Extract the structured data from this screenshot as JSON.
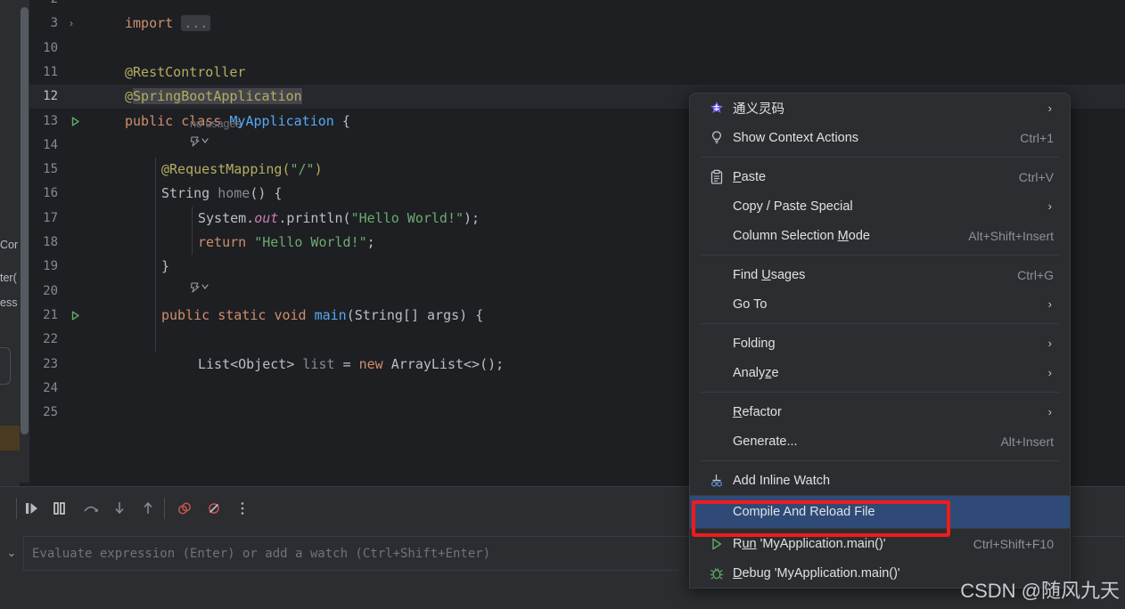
{
  "app": {
    "theme_bg": "#1e1f22",
    "panel_bg": "#2b2d30",
    "accent_selected": "#2f4a76",
    "annotation_color": "#ef1c1c"
  },
  "editor": {
    "lines": [
      {
        "num": "2",
        "indent": 0,
        "segments": []
      },
      {
        "num": "3",
        "indent": 0,
        "fold": "›",
        "segments": [
          {
            "t": "import ",
            "c": "kw"
          },
          {
            "t": "...",
            "c": "dots"
          }
        ]
      },
      {
        "num": "10",
        "indent": 0,
        "segments": []
      },
      {
        "num": "11",
        "indent": 0,
        "segments": [
          {
            "t": "@RestController",
            "c": "anno"
          }
        ]
      },
      {
        "num": "12",
        "indent": 0,
        "current": true,
        "segments": [
          {
            "t": "@",
            "c": "anno"
          },
          {
            "t": "SpringBootApplication",
            "c": "anno sel"
          }
        ]
      },
      {
        "num": "13",
        "indent": 0,
        "run": true,
        "segments": [
          {
            "t": "public ",
            "c": "kw"
          },
          {
            "t": "class ",
            "c": "kw"
          },
          {
            "t": "MyApplication",
            "c": "mth"
          },
          {
            "t": " {",
            "c": "plain"
          }
        ]
      },
      {
        "num": "14",
        "indent": 0,
        "segments": []
      },
      {
        "num": "15",
        "indent": 1,
        "segments": [
          {
            "t": "@RequestMapping(",
            "c": "anno"
          },
          {
            "t": "\"/\"",
            "c": "str"
          },
          {
            "t": ")",
            "c": "anno"
          }
        ]
      },
      {
        "num": "16",
        "indent": 1,
        "segments": [
          {
            "t": "String ",
            "c": "plain"
          },
          {
            "t": "home",
            "c": "dim"
          },
          {
            "t": "() {",
            "c": "plain"
          }
        ]
      },
      {
        "num": "17",
        "indent": 2,
        "segments": [
          {
            "t": "System.",
            "c": "plain"
          },
          {
            "t": "out",
            "c": "fld"
          },
          {
            "t": ".println(",
            "c": "plain"
          },
          {
            "t": "\"Hello World!\"",
            "c": "str"
          },
          {
            "t": ");",
            "c": "plain"
          }
        ]
      },
      {
        "num": "18",
        "indent": 2,
        "segments": [
          {
            "t": "return ",
            "c": "kw"
          },
          {
            "t": "\"Hello World!\"",
            "c": "str"
          },
          {
            "t": ";",
            "c": "plain"
          }
        ]
      },
      {
        "num": "19",
        "indent": 1,
        "segments": [
          {
            "t": "}",
            "c": "plain"
          }
        ]
      },
      {
        "num": "20",
        "indent": 0,
        "segments": []
      },
      {
        "num": "21",
        "indent": 1,
        "run": true,
        "segments": [
          {
            "t": "public ",
            "c": "kw"
          },
          {
            "t": "static ",
            "c": "kw"
          },
          {
            "t": "void ",
            "c": "kw"
          },
          {
            "t": "main",
            "c": "mth"
          },
          {
            "t": "(String[] args) {",
            "c": "plain"
          }
        ]
      },
      {
        "num": "22",
        "indent": 0,
        "segments": []
      },
      {
        "num": "23",
        "indent": 2,
        "segments": [
          {
            "t": "List<Object> ",
            "c": "plain"
          },
          {
            "t": "list ",
            "c": "dim"
          },
          {
            "t": "= ",
            "c": "plain"
          },
          {
            "t": "new ",
            "c": "kw"
          },
          {
            "t": "ArrayList<>();",
            "c": "plain"
          }
        ]
      },
      {
        "num": "24",
        "indent": 0,
        "segments": []
      },
      {
        "num": "25",
        "indent": 0,
        "segments": []
      }
    ],
    "inlay_no_usages": "no usages",
    "left_strip_fragments": [
      "Cor",
      "ter(",
      "ess"
    ]
  },
  "context_menu": {
    "items": [
      {
        "kind": "item",
        "icon": "tongyi-lingma-icon",
        "label": "通义灵码",
        "submenu": true
      },
      {
        "kind": "item",
        "icon": "lightbulb-icon",
        "label": "Show Context Actions",
        "shortcut": "Ctrl+1"
      },
      {
        "kind": "separator"
      },
      {
        "kind": "item",
        "icon": "clipboard-icon",
        "label": "Paste",
        "mnemonic": "P",
        "shortcut": "Ctrl+V"
      },
      {
        "kind": "item",
        "label": "Copy / Paste Special",
        "submenu": true
      },
      {
        "kind": "item",
        "label": "Column Selection Mode",
        "mnemonic": "M",
        "shortcut": "Alt+Shift+Insert"
      },
      {
        "kind": "separator"
      },
      {
        "kind": "item",
        "label": "Find Usages",
        "mnemonic": "U",
        "shortcut": "Ctrl+G"
      },
      {
        "kind": "item",
        "label": "Go To",
        "submenu": true
      },
      {
        "kind": "separator"
      },
      {
        "kind": "item",
        "label": "Folding",
        "submenu": true
      },
      {
        "kind": "item",
        "label": "Analyze",
        "mnemonic": "z",
        "submenu": true
      },
      {
        "kind": "separator"
      },
      {
        "kind": "item",
        "label": "Refactor",
        "mnemonic": "R",
        "submenu": true
      },
      {
        "kind": "item",
        "label": "Generate...",
        "shortcut": "Alt+Insert"
      },
      {
        "kind": "separator"
      },
      {
        "kind": "item",
        "icon": "add-inline-watch-icon",
        "label": "Add Inline Watch"
      },
      {
        "kind": "separator-full"
      },
      {
        "kind": "item",
        "label": "Compile And Reload File",
        "selected": true,
        "annotated": true
      },
      {
        "kind": "separator-full"
      },
      {
        "kind": "item",
        "icon": "run-icon",
        "label": "Run 'MyApplication.main()'",
        "mnemonic": "un",
        "shortcut": "Ctrl+Shift+F10"
      },
      {
        "kind": "item",
        "icon": "debug-icon",
        "label": "Debug 'MyApplication.main()'",
        "mnemonic": "D"
      }
    ]
  },
  "debug_toolbar": {
    "buttons": [
      {
        "name": "resume-program-icon",
        "title": "Resume Program"
      },
      {
        "name": "pause-program-icon",
        "title": "Pause Program"
      },
      {
        "name": "step-over-icon",
        "title": "Step Over"
      },
      {
        "name": "step-into-icon",
        "title": "Step Into"
      },
      {
        "name": "step-out-icon",
        "title": "Step Out"
      },
      {
        "name": "view-breakpoints-icon",
        "title": "View Breakpoints"
      },
      {
        "name": "mute-breakpoints-icon",
        "title": "Mute Breakpoints"
      },
      {
        "name": "more-options-icon",
        "title": "More"
      }
    ]
  },
  "evaluate": {
    "placeholder": "Evaluate expression (Enter) or add a watch (Ctrl+Shift+Enter)",
    "value": ""
  },
  "watermark": {
    "text": "CSDN @随风九天"
  }
}
